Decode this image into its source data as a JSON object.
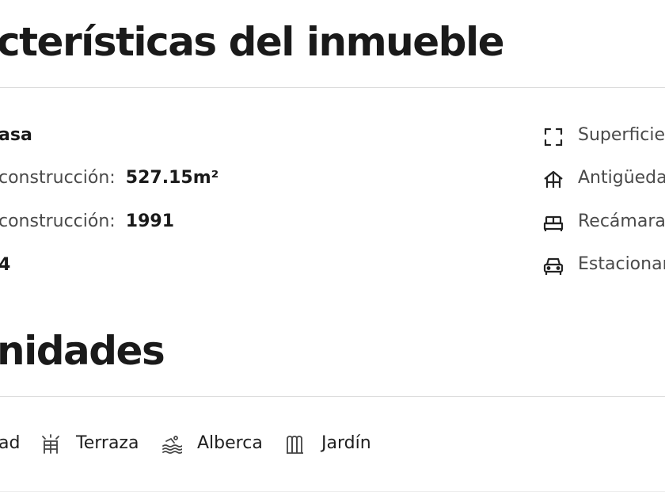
{
  "characteristics": {
    "title": "cterísticas del inmueble",
    "left": {
      "type_value": "asa",
      "construction_label": "construcción:",
      "construction_value": "527.15m²",
      "year_label": "construcción:",
      "year_value": "1991",
      "last_value": "4"
    },
    "right": {
      "surface_label": "Superficie",
      "age_label": "Antigüeda",
      "bedrooms_label": "Recámaras",
      "parking_label": "Estacionar"
    },
    "icons": {
      "surface": "expand-frame-icon",
      "age": "house-roof-icon",
      "bedrooms": "bed-icon",
      "parking": "car-icon"
    }
  },
  "amenities": {
    "title": "nidades",
    "items": [
      {
        "label": "ad",
        "icon": null
      },
      {
        "label": "Terraza",
        "icon": "terrace-icon"
      },
      {
        "label": "Alberca",
        "icon": "pool-icon"
      },
      {
        "label": "Jardín",
        "icon": "garden-fence-icon"
      }
    ]
  }
}
